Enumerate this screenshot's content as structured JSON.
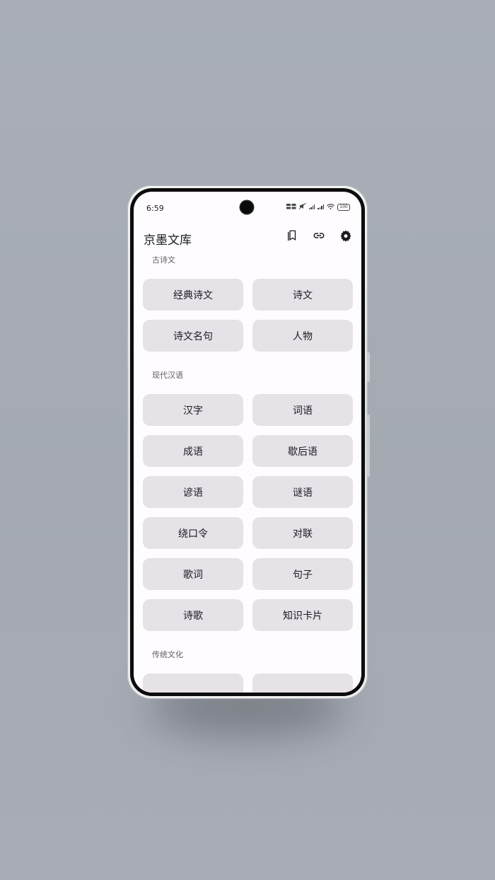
{
  "status": {
    "time": "6:59",
    "battery": "100",
    "network": "5G"
  },
  "app": {
    "title": "京墨文库",
    "actions": [
      "bookmark-icon",
      "link-icon",
      "settings-icon"
    ]
  },
  "sections": [
    {
      "label": "古诗文",
      "items": [
        "经典诗文",
        "诗文",
        "诗文名句",
        "人物"
      ]
    },
    {
      "label": "现代汉语",
      "items": [
        "汉字",
        "词语",
        "成语",
        "歇后语",
        "谚语",
        "谜语",
        "绕口令",
        "对联",
        "歌词",
        "句子",
        "诗歌",
        "知识卡片"
      ]
    },
    {
      "label": "传统文化",
      "items": [
        "",
        ""
      ]
    }
  ],
  "colors": {
    "background": "#a9aeb7",
    "screen": "#fefcfe",
    "button": "#e7e1e8",
    "text": "#1d1b20",
    "label": "#5f5d64"
  }
}
